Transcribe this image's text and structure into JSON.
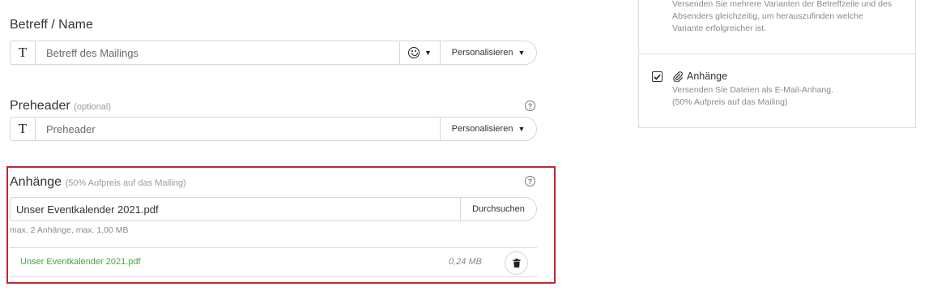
{
  "subject": {
    "title": "Betreff / Name",
    "placeholder": "Betreff des Mailings",
    "t_glyph": "T",
    "personalize_label": "Personalisieren"
  },
  "preheader": {
    "title": "Preheader",
    "optional_label": "(optional)",
    "placeholder": "Preheader",
    "t_glyph": "T",
    "personalize_label": "Personalisieren",
    "help_glyph": "?"
  },
  "attachments": {
    "title": "Anhänge",
    "surcharge_label": "(50% Aufpreis auf das Mailing)",
    "file_input_value": "Unser Eventkalender 2021.pdf",
    "browse_label": "Durchsuchen",
    "limits_hint": "max. 2 Anhänge, max. 1,00 MB",
    "help_glyph": "?",
    "files": [
      {
        "name": "Unser Eventkalender 2021.pdf",
        "size": "0,24 MB"
      }
    ]
  },
  "right_panel": {
    "variants_description_lines": [
      "Versenden Sie mehrere Varianten der Betreffzeile und des",
      "Absenders gleichzeitig, um herauszufinden welche",
      "Variante erfolgreicher ist."
    ],
    "attachments_option": {
      "title": "Anhänge",
      "checked": true,
      "description_lines": [
        "Versenden Sie Dateien als E-Mail-Anhang.",
        "(50% Aufpreis auf das Mailing)"
      ]
    }
  },
  "colors": {
    "highlight_border": "#c0272d",
    "file_link": "#4aa148"
  }
}
